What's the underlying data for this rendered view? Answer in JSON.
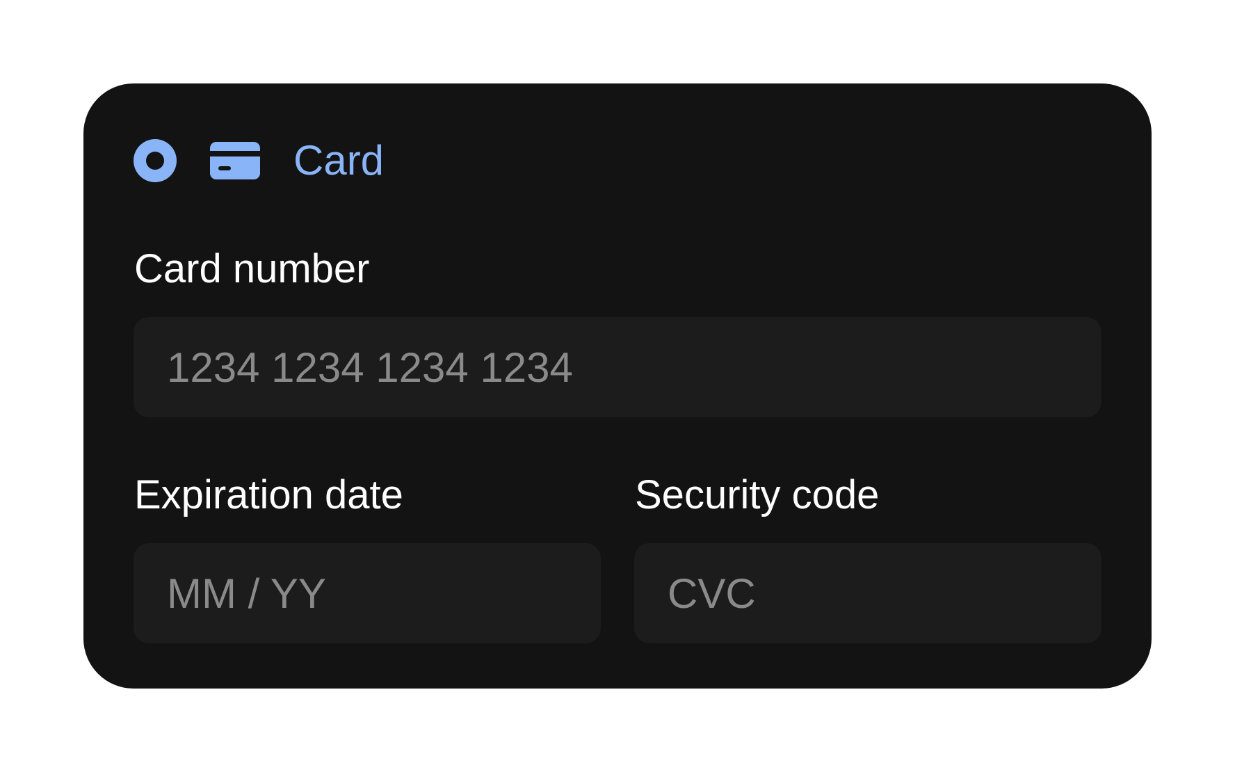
{
  "payment_method": {
    "label": "Card",
    "selected": true,
    "icons": [
      "radio-selected-icon",
      "credit-card-icon"
    ],
    "accent_color": "#8ab4f8"
  },
  "fields": {
    "card_number": {
      "label": "Card number",
      "placeholder": "1234 1234 1234 1234",
      "value": ""
    },
    "expiration": {
      "label": "Expiration date",
      "placeholder": "MM / YY",
      "value": ""
    },
    "security_code": {
      "label": "Security code",
      "placeholder": "CVC",
      "value": ""
    }
  }
}
